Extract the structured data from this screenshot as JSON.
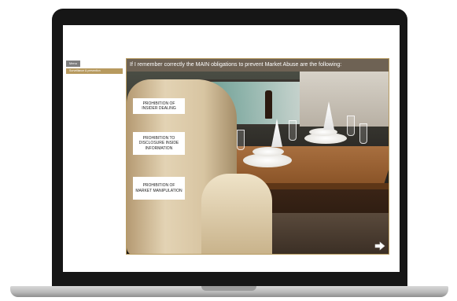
{
  "sidebar": {
    "menu_button": "Menu",
    "items": [
      {
        "label": "Surveillance & prevention"
      }
    ]
  },
  "slide": {
    "title": "If I remember correctly the MAIN obligations to prevent Market Abuse are the following:",
    "obligations": [
      {
        "label": "PROHIBITION OF INSIDER DEALING"
      },
      {
        "label": "PROHIBITION TO DISCLOSURE INSIDE INFORMATION"
      },
      {
        "label": "PROHIBITION OF MARKET MANIPULATION"
      }
    ],
    "next_icon": "arrow-right-icon"
  },
  "colors": {
    "accent_gold": "#b79a5f",
    "title_bar": "#6e6254",
    "menu_button": "#7e7e7e"
  }
}
